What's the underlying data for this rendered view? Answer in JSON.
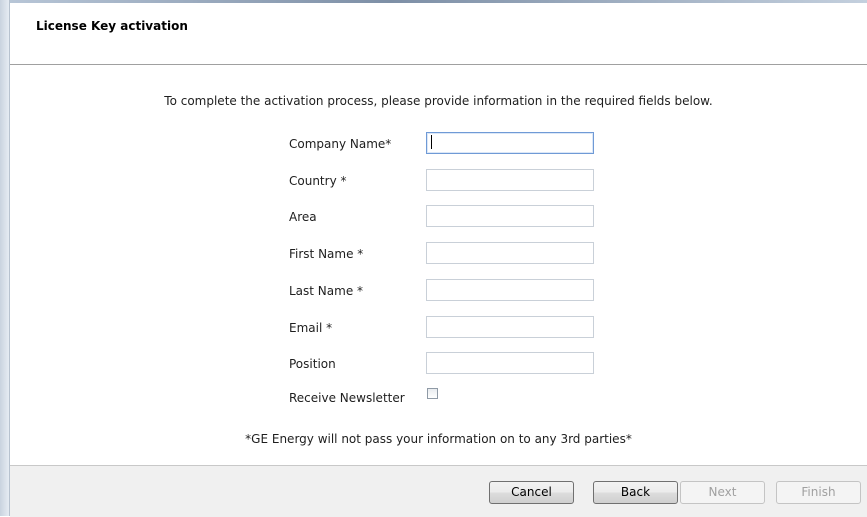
{
  "header": {
    "title": "License Key activation"
  },
  "instructions": "To complete the activation process, please provide information in the required fields below.",
  "form": {
    "fields": [
      {
        "label": "Company Name*",
        "value": "",
        "placeholder": ""
      },
      {
        "label": "Country  *",
        "value": "",
        "placeholder": ""
      },
      {
        "label": "Area",
        "value": "",
        "placeholder": ""
      },
      {
        "label": "First Name  *",
        "value": "",
        "placeholder": ""
      },
      {
        "label": "Last Name  *",
        "value": "",
        "placeholder": ""
      },
      {
        "label": "Email  *",
        "value": "",
        "placeholder": ""
      },
      {
        "label": "Position",
        "value": "",
        "placeholder": ""
      }
    ],
    "newsletter_label": "Receive Newsletter",
    "newsletter_checked": false
  },
  "disclaimer": "*GE Energy will not pass your information on to any 3rd parties*",
  "buttons": {
    "cancel": "Cancel",
    "back": "Back",
    "next": "Next",
    "finish": "Finish"
  },
  "colors": {
    "focus_border": "#6f9ad6",
    "footer_bg": "#f0f0f0"
  }
}
